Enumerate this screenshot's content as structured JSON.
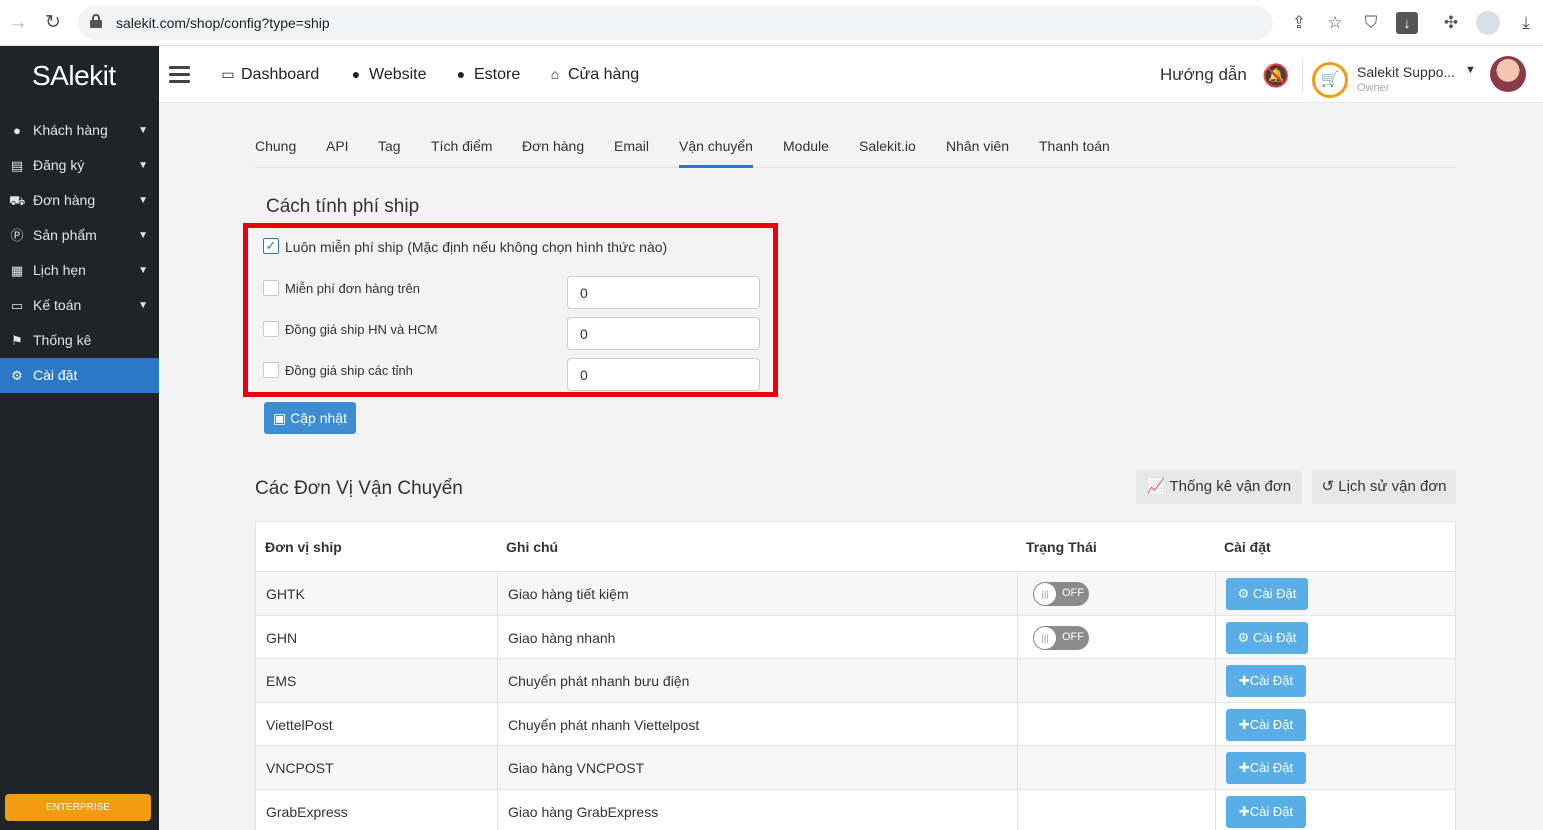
{
  "browser": {
    "url": "salekit.com/shop/config?type=ship"
  },
  "sidebar": {
    "logo": "SAlekit",
    "items": [
      {
        "label": "Khách hàng",
        "icon": "user-icon"
      },
      {
        "label": "Đăng ký",
        "icon": "list-icon"
      },
      {
        "label": "Đơn hàng",
        "icon": "cart-icon"
      },
      {
        "label": "Sản phẩm",
        "icon": "product-icon"
      },
      {
        "label": "Lịch hẹn",
        "icon": "calendar-icon"
      },
      {
        "label": "Kế toán",
        "icon": "card-icon"
      },
      {
        "label": "Thống kê",
        "icon": "flag-icon"
      },
      {
        "label": "Cài đặt",
        "icon": "gear-icon"
      }
    ],
    "badge": "ENTERPRISE"
  },
  "topbar": {
    "links": [
      "Dashboard",
      "Website",
      "Estore",
      "Cửa hàng"
    ],
    "guide": "Hướng dẫn",
    "user_name": "Salekit Suppo...",
    "user_role": "Owner"
  },
  "tabs": [
    "Chung",
    "API",
    "Tag",
    "Tích điểm",
    "Đơn hàng",
    "Email",
    "Vận chuyển",
    "Module",
    "Salekit.io",
    "Nhân viên",
    "Thanh toán"
  ],
  "shipping": {
    "title": "Cách tính phí ship",
    "always_free": "Luôn miễn phí ship (Mặc định nếu không chọn hình thức nào)",
    "options": [
      {
        "label": "Miễn phí đơn hàng trên",
        "value": "0"
      },
      {
        "label": "Đồng giá ship HN và HCM",
        "value": "0"
      },
      {
        "label": "Đồng giá ship các tỉnh",
        "value": "0"
      }
    ],
    "update_button": "Cập nhật"
  },
  "carriers": {
    "title": "Các Đơn Vị Vận Chuyển",
    "stats_button": "Thống kê vận đơn",
    "history_button": "Lịch sử vận đơn",
    "headers": [
      "Đơn vị ship",
      "Ghi chú",
      "Trạng Thái",
      "Cài đặt"
    ],
    "rows": [
      {
        "name": "GHTK",
        "note": "Giao hàng tiết kiệm",
        "status": "OFF",
        "action": "Cài Đặt"
      },
      {
        "name": "GHN",
        "note": "Giao hàng nhanh",
        "status": "OFF",
        "action": "Cài Đặt"
      },
      {
        "name": "EMS",
        "note": "Chuyển phát nhanh bưu điện",
        "status": "",
        "action": "Cài Đặt"
      },
      {
        "name": "ViettelPost",
        "note": "Chuyển phát nhanh Viettelpost",
        "status": "",
        "action": "Cài Đặt"
      },
      {
        "name": "VNCPOST",
        "note": "Giao hàng VNCPOST",
        "status": "",
        "action": "Cài Đặt"
      },
      {
        "name": "GrabExpress",
        "note": "Giao hàng GrabExpress",
        "status": "",
        "action": "Cài Đặt"
      }
    ]
  }
}
